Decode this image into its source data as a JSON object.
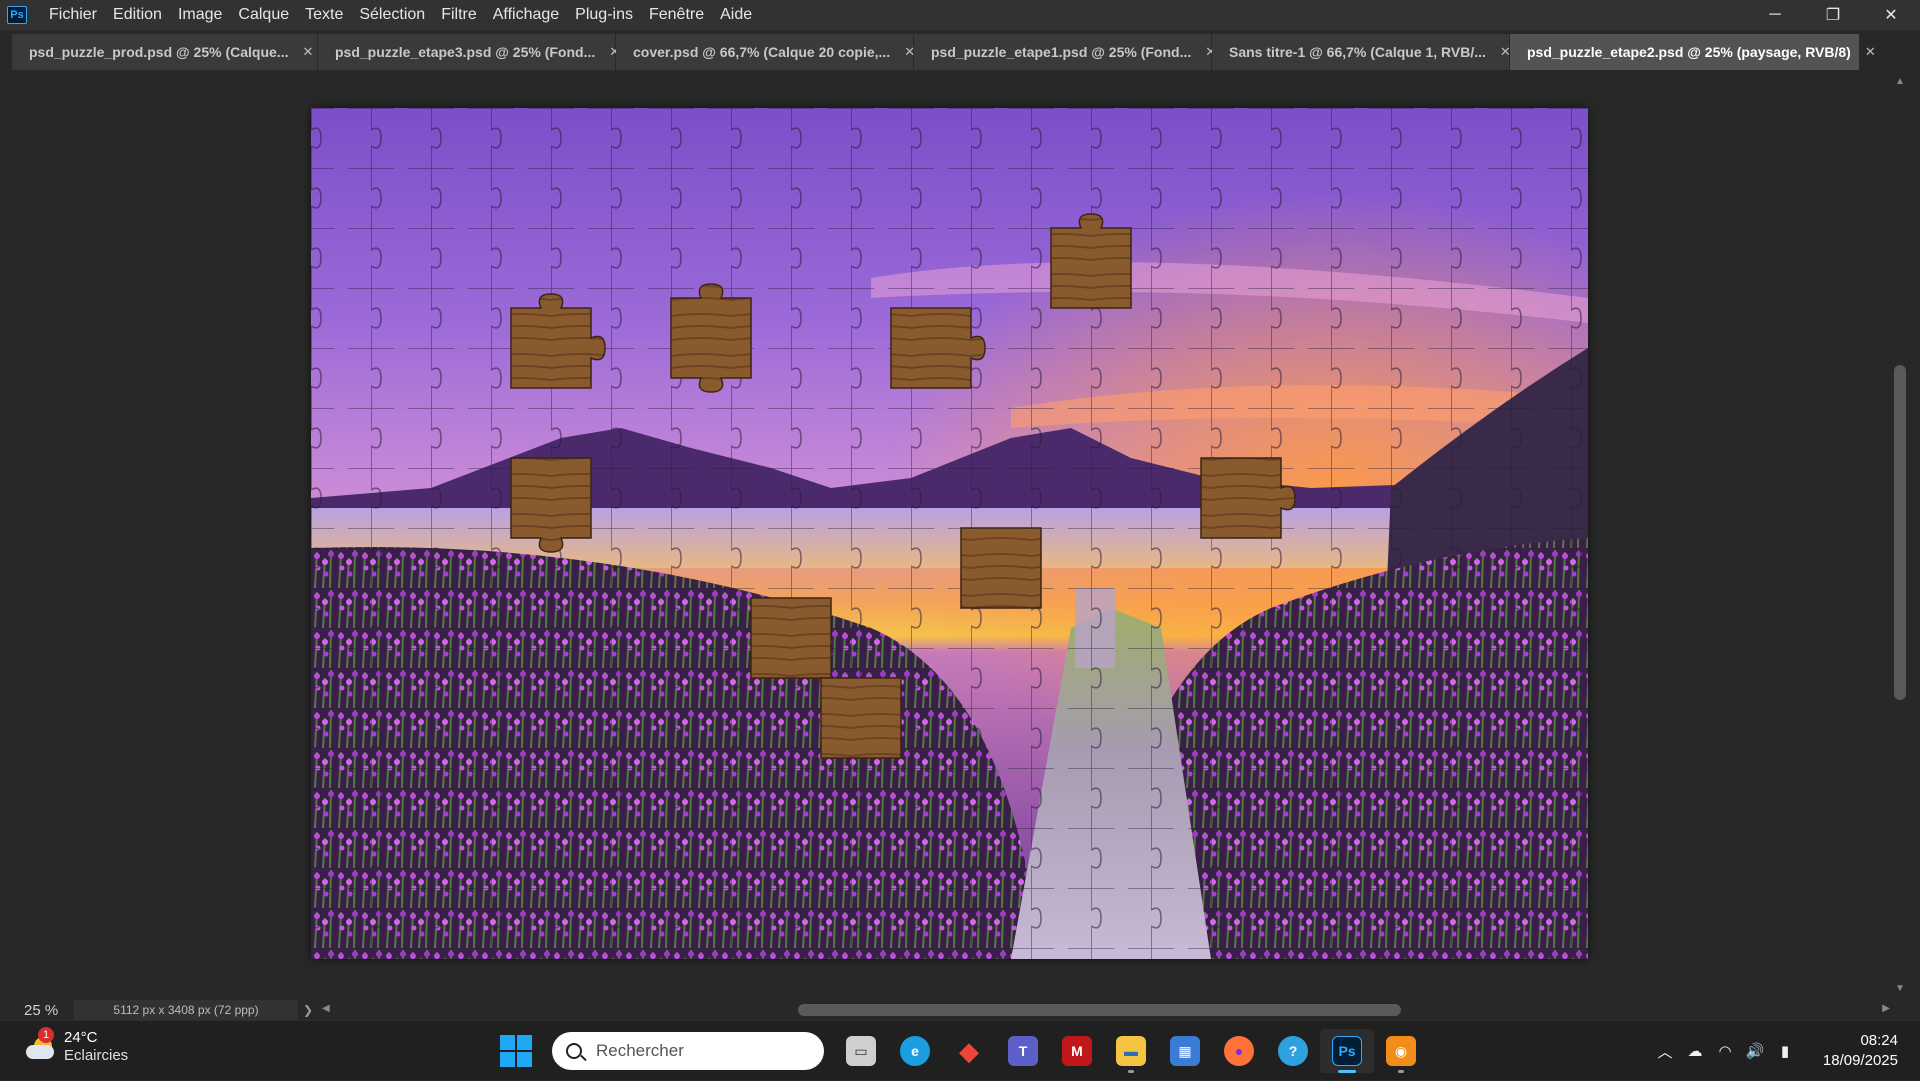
{
  "menu": {
    "app_icon": "Ps",
    "items": [
      "Fichier",
      "Edition",
      "Image",
      "Calque",
      "Texte",
      "Sélection",
      "Filtre",
      "Affichage",
      "Plug-ins",
      "Fenêtre",
      "Aide"
    ]
  },
  "window_controls": {
    "minimize": "─",
    "restore": "❐",
    "close": "✕"
  },
  "tabs": [
    {
      "label": "psd_puzzle_prod.psd @ 25% (Calque...",
      "active": false
    },
    {
      "label": "psd_puzzle_etape3.psd @ 25% (Fond...",
      "active": false
    },
    {
      "label": "cover.psd @ 66,7% (Calque 20 copie,...",
      "active": false
    },
    {
      "label": "psd_puzzle_etape1.psd @ 25% (Fond...",
      "active": false
    },
    {
      "label": "Sans titre-1 @ 66,7% (Calque 1, RVB/...",
      "active": false
    },
    {
      "label": "psd_puzzle_etape2.psd @ 25% (paysage, RVB/8)",
      "active": true
    }
  ],
  "tab_close": "✕",
  "status": {
    "zoom": "25 %",
    "doc_info": "5112 px x 3408 px (72 ppp)",
    "info_arrow": "❯"
  },
  "taskbar": {
    "weather_temp": "24°C",
    "weather_condition": "Eclaircies",
    "weather_badge": "1",
    "search_placeholder": "Rechercher",
    "apps": [
      {
        "name": "task-view",
        "color": "#cfcfcf",
        "glyph": "▭"
      },
      {
        "name": "edge",
        "color": "#1b9de2",
        "glyph": "e"
      },
      {
        "name": "anydesk",
        "color": "#ef443b",
        "glyph": "◆"
      },
      {
        "name": "teams",
        "color": "#5b5fc7",
        "glyph": "T"
      },
      {
        "name": "mcafee",
        "color": "#c01818",
        "glyph": "M"
      },
      {
        "name": "file-explorer",
        "color": "#f4c542",
        "glyph": "▬"
      },
      {
        "name": "store",
        "color": "#3a7bd5",
        "glyph": "▦"
      },
      {
        "name": "firefox",
        "color": "#ff7139",
        "glyph": "●"
      },
      {
        "name": "edge-beta",
        "color": "#2fa1e0",
        "glyph": "?"
      },
      {
        "name": "photoshop",
        "color": "#001e36",
        "glyph": "Ps"
      },
      {
        "name": "vlc-like",
        "color": "#f28c1b",
        "glyph": "◉"
      }
    ],
    "tray": {
      "chevron": "︿",
      "cloud": "☁",
      "wifi": "◠",
      "volume": "🔊",
      "battery": "▮"
    },
    "time": "08:24",
    "date": "18/09/2025"
  }
}
